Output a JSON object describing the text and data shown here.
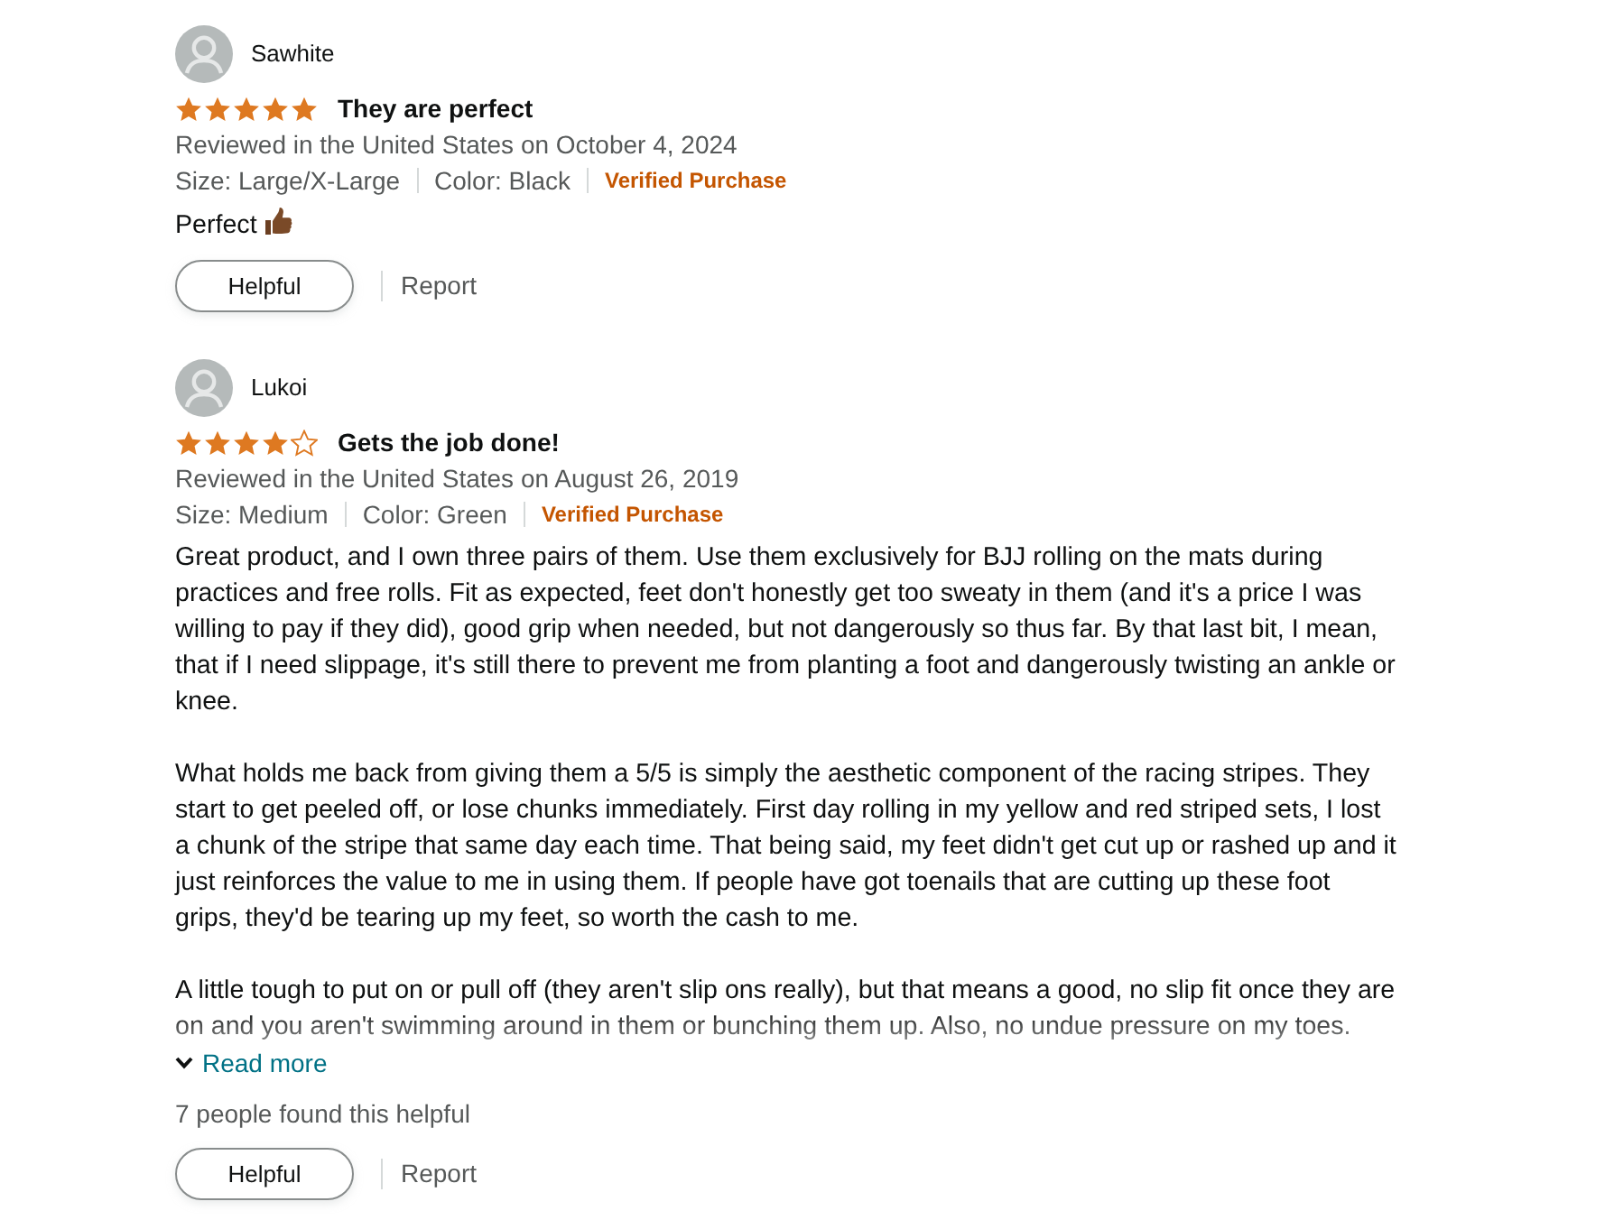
{
  "reviews": [
    {
      "author": "Sawhite",
      "stars": 5,
      "title": "They are perfect",
      "date_line": "Reviewed in the United States on October 4, 2024",
      "attributes": [
        "Size: Large/X-Large",
        "Color: Black"
      ],
      "verified": "Verified Purchase",
      "body": [
        {
          "text": "Perfect",
          "emoji": true
        }
      ],
      "truncated": false,
      "actions": {
        "helpful": "Helpful",
        "report": "Report"
      }
    },
    {
      "author": "Lukoi",
      "stars": 4,
      "title": "Gets the job done!",
      "date_line": "Reviewed in the United States on August 26, 2019",
      "attributes": [
        "Size: Medium",
        "Color: Green"
      ],
      "verified": "Verified Purchase",
      "body": [
        {
          "text": "Great product, and I own three pairs of them. Use them exclusively for BJJ rolling on the mats during practices and free rolls. Fit as expected, feet don't honestly get too sweaty in them (and it's a price I was willing to pay if they did), good grip when needed, but not dangerously so thus far. By that last bit, I mean, that if I need slippage, it's still there to prevent me from planting a foot and dangerously twisting an ankle or knee.",
          "emoji": false
        },
        {
          "text": "What holds me back from giving them a 5/5 is simply the aesthetic component of the racing stripes. They start to get peeled off, or lose chunks immediately. First day rolling in my yellow and red striped sets, I lost a chunk of the stripe that same day each time. That being said, my feet didn't get cut up or rashed up and it just reinforces the value to me in using them. If people have got toenails that are cutting up these foot grips, they'd be tearing up my feet, so worth the cash to me.",
          "emoji": false
        },
        {
          "text": "A little tough to put on or pull off (they aren't slip ons really), but that means a good, no slip fit once they are on and you aren't swimming around in them or bunching them up. Also, no undue pressure on my toes.",
          "emoji": false
        }
      ],
      "truncated": true,
      "read_more": "Read more",
      "helpful_count": "7 people found this helpful",
      "actions": {
        "helpful": "Helpful",
        "report": "Report"
      }
    }
  ]
}
